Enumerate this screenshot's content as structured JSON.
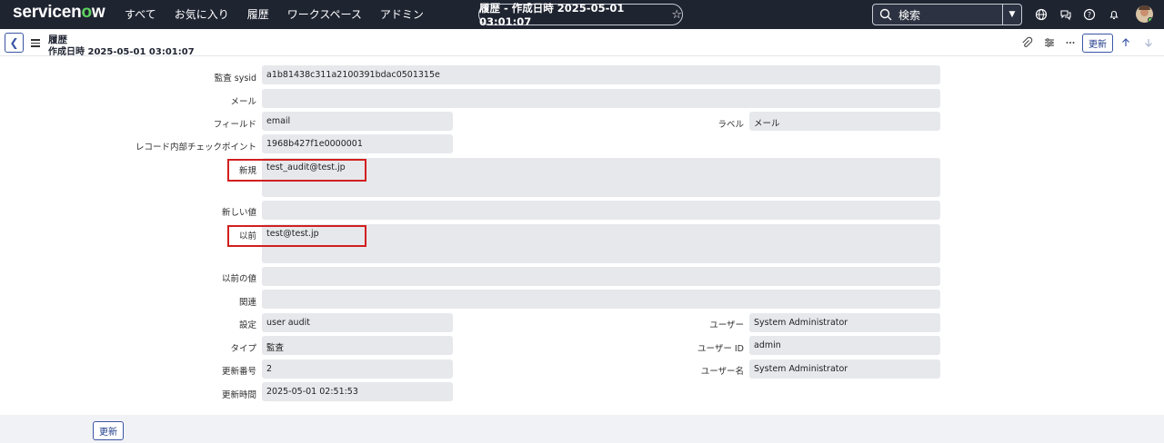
{
  "topnav": {
    "logo": "servicenow",
    "menu": [
      "すべて",
      "お気に入り",
      "履歴",
      "ワークスペース",
      "アドミン"
    ],
    "context_pill": "履歴 - 作成日時 2025-05-01 03:01:07",
    "search_placeholder": "検索"
  },
  "form_header": {
    "title": "履歴",
    "subtitle": "作成日時 2025-05-01 03:01:07",
    "update_label": "更新"
  },
  "form": {
    "audit_sysid": {
      "label": "監査 sysid",
      "value": "a1b81438c311a2100391bdac0501315e"
    },
    "mail": {
      "label": "メール",
      "value": ""
    },
    "field": {
      "label": "フィールド",
      "value": "email"
    },
    "field_label": {
      "label": "ラベル",
      "value": "メール"
    },
    "checkpoint": {
      "label": "レコード内部チェックポイント",
      "value": "1968b427f1e0000001"
    },
    "new": {
      "label": "新規",
      "value": "test_audit@test.jp"
    },
    "new_value": {
      "label": "新しい値",
      "value": ""
    },
    "old": {
      "label": "以前",
      "value": "test@test.jp"
    },
    "old_value": {
      "label": "以前の値",
      "value": ""
    },
    "related": {
      "label": "関連",
      "value": ""
    },
    "setting": {
      "label": "設定",
      "value": "user audit"
    },
    "user": {
      "label": "ユーザー",
      "value": "System Administrator"
    },
    "type": {
      "label": "タイプ",
      "value": "監査"
    },
    "user_id": {
      "label": "ユーザー ID",
      "value": "admin"
    },
    "update_count": {
      "label": "更新番号",
      "value": "2"
    },
    "user_name": {
      "label": "ユーザー名",
      "value": "System Administrator"
    },
    "update_time": {
      "label": "更新時間",
      "value": "2025-05-01 02:51:53"
    }
  },
  "footer": {
    "update_label": "更新"
  },
  "colors": {
    "nav_bg": "#1f2431",
    "field_bg": "#e6e8ec",
    "highlight": "#d21f1f",
    "accent": "#3a55a5"
  }
}
